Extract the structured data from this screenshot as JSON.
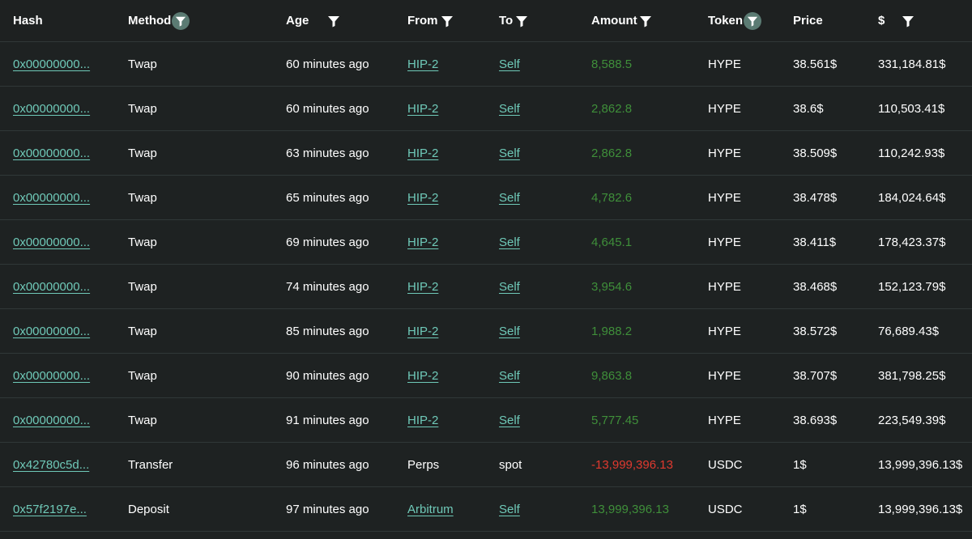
{
  "header": {
    "hash": "Hash",
    "method": "Method",
    "age": "Age",
    "from": "From",
    "to": "To",
    "amount": "Amount",
    "token": "Token",
    "price": "Price",
    "usd": "$"
  },
  "icons": {
    "filter": "filter-icon"
  },
  "colors": {
    "link": "#6fc9b8",
    "positive": "#3f8f3a",
    "negative": "#e0392f",
    "background": "#1e2222"
  },
  "rows": [
    {
      "hash": "0x00000000...",
      "method": "Twap",
      "age": "60 minutes ago",
      "from": "HIP-2",
      "to": "Self",
      "amount": "8,588.5",
      "token": "HYPE",
      "price": "38.561$",
      "usd": "331,184.81$"
    },
    {
      "hash": "0x00000000...",
      "method": "Twap",
      "age": "60 minutes ago",
      "from": "HIP-2",
      "to": "Self",
      "amount": "2,862.8",
      "token": "HYPE",
      "price": "38.6$",
      "usd": "110,503.41$"
    },
    {
      "hash": "0x00000000...",
      "method": "Twap",
      "age": "63 minutes ago",
      "from": "HIP-2",
      "to": "Self",
      "amount": "2,862.8",
      "token": "HYPE",
      "price": "38.509$",
      "usd": "110,242.93$"
    },
    {
      "hash": "0x00000000...",
      "method": "Twap",
      "age": "65 minutes ago",
      "from": "HIP-2",
      "to": "Self",
      "amount": "4,782.6",
      "token": "HYPE",
      "price": "38.478$",
      "usd": "184,024.64$"
    },
    {
      "hash": "0x00000000...",
      "method": "Twap",
      "age": "69 minutes ago",
      "from": "HIP-2",
      "to": "Self",
      "amount": "4,645.1",
      "token": "HYPE",
      "price": "38.411$",
      "usd": "178,423.37$"
    },
    {
      "hash": "0x00000000...",
      "method": "Twap",
      "age": "74 minutes ago",
      "from": "HIP-2",
      "to": "Self",
      "amount": "3,954.6",
      "token": "HYPE",
      "price": "38.468$",
      "usd": "152,123.79$"
    },
    {
      "hash": "0x00000000...",
      "method": "Twap",
      "age": "85 minutes ago",
      "from": "HIP-2",
      "to": "Self",
      "amount": "1,988.2",
      "token": "HYPE",
      "price": "38.572$",
      "usd": "76,689.43$"
    },
    {
      "hash": "0x00000000...",
      "method": "Twap",
      "age": "90 minutes ago",
      "from": "HIP-2",
      "to": "Self",
      "amount": "9,863.8",
      "token": "HYPE",
      "price": "38.707$",
      "usd": "381,798.25$"
    },
    {
      "hash": "0x00000000...",
      "method": "Twap",
      "age": "91 minutes ago",
      "from": "HIP-2",
      "to": "Self",
      "amount": "5,777.45",
      "token": "HYPE",
      "price": "38.693$",
      "usd": "223,549.39$"
    },
    {
      "hash": "0x42780c5d...",
      "method": "Transfer",
      "age": "96 minutes ago",
      "from": "Perps",
      "to": "spot",
      "amount": "-13,999,396.13",
      "token": "USDC",
      "price": "1$",
      "usd": "13,999,396.13$"
    },
    {
      "hash": "0x57f2197e...",
      "method": "Deposit",
      "age": "97 minutes ago",
      "from": "Arbitrum",
      "to": "Self",
      "amount": "13,999,396.13",
      "token": "USDC",
      "price": "1$",
      "usd": "13,999,396.13$"
    }
  ]
}
